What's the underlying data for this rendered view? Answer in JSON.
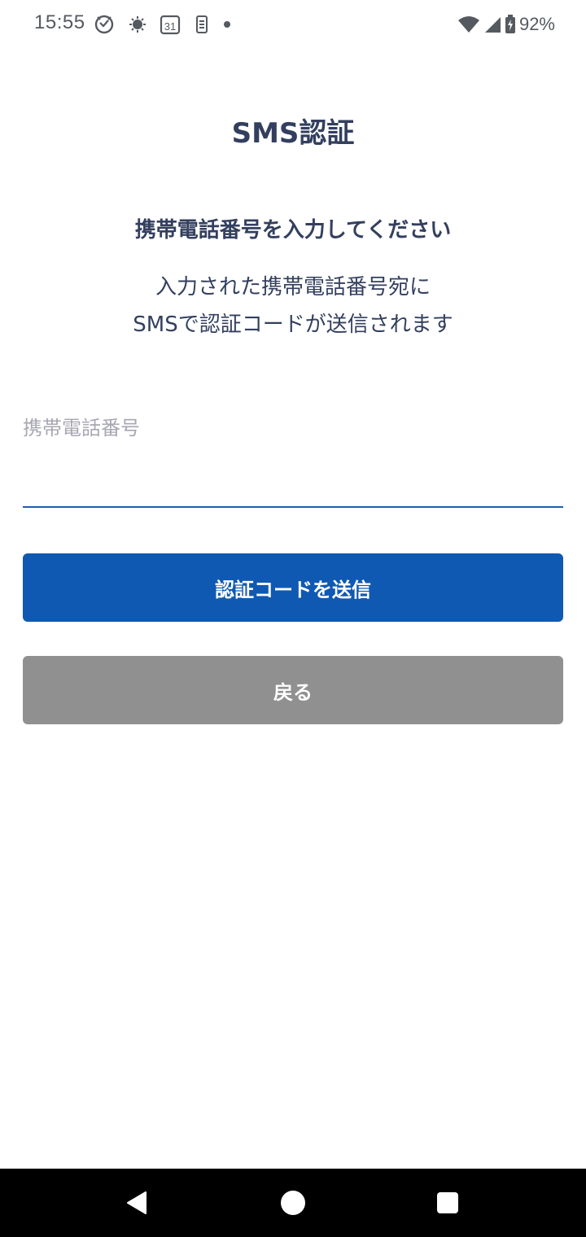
{
  "status_bar": {
    "time": "15:55",
    "battery": "92%",
    "calendar_day": "31",
    "icons_left": [
      "notification-icon",
      "weather-icon",
      "calendar-icon",
      "device-icon",
      "dot-icon"
    ],
    "icons_right": [
      "wifi-icon",
      "signal-icon",
      "battery-icon"
    ]
  },
  "page": {
    "title": "SMS認証",
    "heading": "携帯電話番号を入力してください",
    "description_line1": "入力された携帯電話番号宛に",
    "description_line2": "SMSで認証コードが送信されます"
  },
  "form": {
    "phone_label": "携帯電話番号",
    "phone_value": ""
  },
  "buttons": {
    "send_code": "認証コードを送信",
    "back": "戻る"
  },
  "colors": {
    "primary": "#0f59b2",
    "secondary": "#909090",
    "text": "#333f5e",
    "placeholder": "#a7a7b3",
    "underline": "#1f5fae"
  },
  "nav_bar": {
    "icons": [
      "back-icon",
      "home-icon",
      "recents-icon"
    ]
  }
}
